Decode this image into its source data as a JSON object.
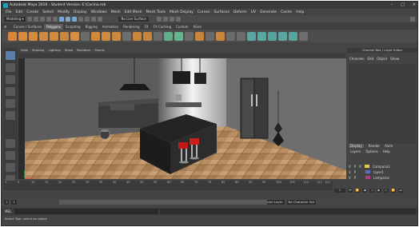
{
  "window": {
    "title": "Autodesk Maya 2016 - Student Version: E:\\Cocina.mb"
  },
  "menus": [
    "File",
    "Edit",
    "Create",
    "Select",
    "Modify",
    "Display",
    "Windows",
    "Mesh",
    "Edit Mesh",
    "Mesh Tools",
    "Mesh Display",
    "Curves",
    "Surfaces",
    "Deform",
    "UV",
    "Generate",
    "Cache",
    "Help"
  ],
  "status": {
    "mode": "Modeling",
    "live_surface": "No Live Surface"
  },
  "shelf_tabs": [
    "Curves / Surfaces",
    "Polygons",
    "Sculpting",
    "Rigging",
    "Animation",
    "Rendering",
    "FX",
    "FX Caching",
    "Custom",
    "XGen"
  ],
  "shelf_active": "Polygons",
  "viewport_menu": [
    "View",
    "Shading",
    "Lighting",
    "Show",
    "Renderer",
    "Panels"
  ],
  "channel_box": {
    "header": "Channel Box / Layer Editor",
    "menus": [
      "Channels",
      "Edit",
      "Object",
      "Show"
    ]
  },
  "layer_editor": {
    "tabs": [
      "Display",
      "Render",
      "Anim"
    ],
    "menus": [
      "Layers",
      "Options",
      "Help"
    ],
    "layers": [
      {
        "v": "V",
        "p": "P",
        "r": "R",
        "name": "Campana1",
        "color": "#e8c84a"
      },
      {
        "v": "V",
        "p": "P",
        "r": "",
        "name": "layer1",
        "color": "#5a6fb8"
      },
      {
        "v": "V",
        "p": "P",
        "r": "",
        "name": "Lamparas",
        "color": "#b83a8a"
      }
    ]
  },
  "timeline": {
    "ticks": [
      "1",
      "5",
      "10",
      "15",
      "20",
      "25",
      "30",
      "35",
      "40",
      "45",
      "50",
      "55",
      "60",
      "65",
      "70",
      "75",
      "80",
      "85",
      "90",
      "95",
      "100",
      "105",
      "110",
      "115",
      "120"
    ],
    "current_frame": "1"
  },
  "range": {
    "start": "1",
    "start2": "1",
    "end_inner": "120",
    "end": "120",
    "end2": "200",
    "anim_layer": "No Anim Layer",
    "char_set": "No Character Set"
  },
  "mel": {
    "label": "MEL"
  },
  "help_line": "Select Tool: select an object"
}
